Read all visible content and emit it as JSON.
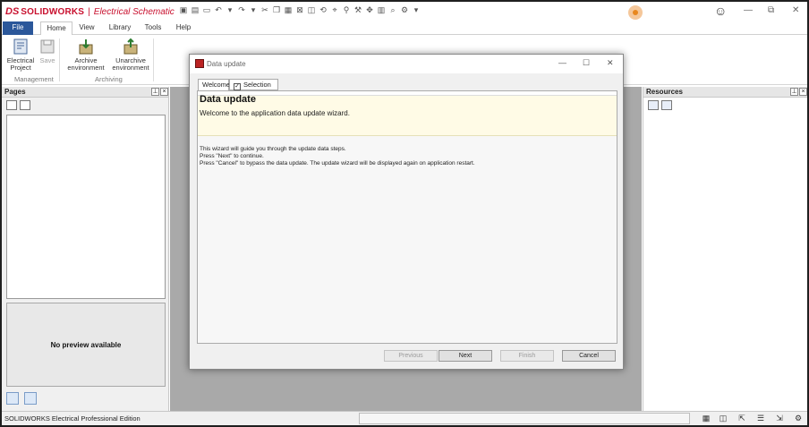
{
  "app": {
    "logo_ds": "DS",
    "brand": "SOLIDWORKS",
    "separator": "|",
    "product": "Electrical Schematic"
  },
  "tabs": [
    {
      "label": "File"
    },
    {
      "label": "Home"
    },
    {
      "label": "View"
    },
    {
      "label": "Library"
    },
    {
      "label": "Tools"
    },
    {
      "label": "Help"
    }
  ],
  "ribbon": {
    "electrical_project": "Electrical\nProject",
    "save": "Save",
    "archive_environment": "Archive\nenvironment",
    "unarchive_environment": "Unarchive\nenvironment",
    "group_management": "Management",
    "group_archiving": "Archiving"
  },
  "pages_panel": {
    "title": "Pages",
    "preview_text": "No preview available"
  },
  "resources_panel": {
    "title": "Resources"
  },
  "status": {
    "edition": "SOLIDWORKS Electrical Professional Edition"
  },
  "dialog": {
    "title": "Data update",
    "tab_welcome": "Welcome",
    "tab_selection": "Selection",
    "heading": "Data update",
    "subheading": "Welcome to the application data update wizard.",
    "body_line1": "This wizard will guide you through the update data steps.",
    "body_line2": "Press \"Next\" to continue.",
    "body_line3": "Press \"Cancel\" to bypass the data update. The update wizard will be displayed again on application restart.",
    "btn_previous": "Previous",
    "btn_next": "Next",
    "btn_finish": "Finish",
    "btn_cancel": "Cancel"
  },
  "colors": {
    "brand_red": "#c8102e",
    "file_tab_blue": "#2b579a",
    "workspace_grey": "#a9a9a9",
    "dialog_header_yellow": "#fffbe6"
  }
}
